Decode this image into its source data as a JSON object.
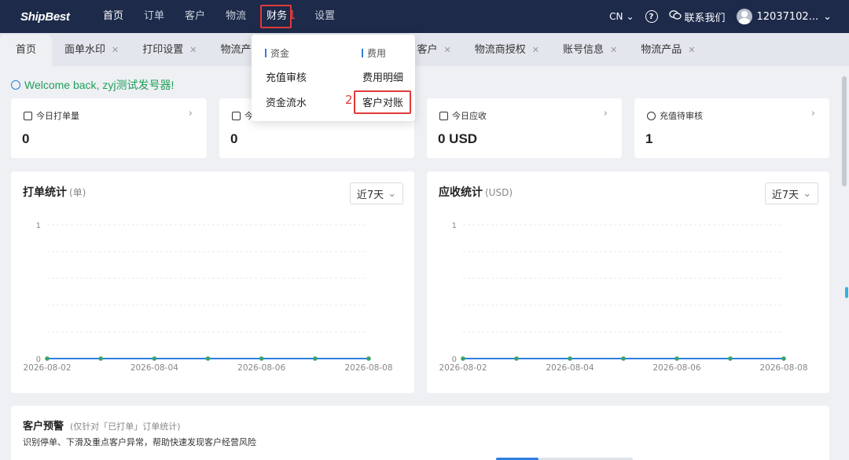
{
  "app": {
    "logo": "ShipBest"
  },
  "nav": {
    "items": [
      {
        "label": "首页"
      },
      {
        "label": "订单"
      },
      {
        "label": "客户"
      },
      {
        "label": "物流"
      },
      {
        "label": "财务"
      },
      {
        "label": "设置"
      }
    ],
    "step1": "1"
  },
  "top_right": {
    "lang": "CN",
    "contact": "联系我们",
    "user": "12037102..."
  },
  "tabs": [
    {
      "label": "首页"
    },
    {
      "label": "面单水印"
    },
    {
      "label": "打印设置"
    },
    {
      "label": "物流产品"
    },
    {
      "label": "客户"
    },
    {
      "label": "物流商授权"
    },
    {
      "label": "账号信息"
    },
    {
      "label": "物流产品"
    }
  ],
  "welcome": "Welcome back, zyj测试发号器!",
  "stats": [
    {
      "label": "今日打单量",
      "value": "0"
    },
    {
      "label": "今",
      "value": "0"
    },
    {
      "label": "今日应收",
      "value": "0 USD"
    },
    {
      "label": "充值待审核",
      "value": "1"
    }
  ],
  "dropdown": {
    "col1_head": "资金",
    "col2_head": "费用",
    "col1_items": [
      "充值审核",
      "资金流水"
    ],
    "col2_items": [
      "费用明细",
      "客户对账"
    ],
    "step2": "2"
  },
  "charts_ui": {
    "left_title": "打单统计",
    "left_unit": "(单)",
    "right_title": "应收统计",
    "right_unit": "(USD)",
    "range": "近7天"
  },
  "chart_data": [
    {
      "type": "line",
      "title": "打单统计",
      "ylabel": "单",
      "x": [
        "2026-08-02",
        "2026-08-03",
        "2026-08-04",
        "2026-08-05",
        "2026-08-06",
        "2026-08-07",
        "2026-08-08"
      ],
      "xticks": [
        "2026-08-02",
        "2026-08-04",
        "2026-08-06",
        "2026-08-08"
      ],
      "yticks": [
        "0",
        "1"
      ],
      "values": [
        0,
        0,
        0,
        0,
        0,
        0,
        0
      ],
      "ylim": [
        0,
        1
      ],
      "color": "#2f7fe0",
      "point_color": "#3ba26a"
    },
    {
      "type": "line",
      "title": "应收统计",
      "ylabel": "USD",
      "x": [
        "2026-08-02",
        "2026-08-03",
        "2026-08-04",
        "2026-08-05",
        "2026-08-06",
        "2026-08-07",
        "2026-08-08"
      ],
      "xticks": [
        "2026-08-02",
        "2026-08-04",
        "2026-08-06",
        "2026-08-08"
      ],
      "yticks": [
        "0",
        "1"
      ],
      "values": [
        0,
        0,
        0,
        0,
        0,
        0,
        0
      ],
      "ylim": [
        0,
        1
      ],
      "color": "#2f7fe0",
      "point_color": "#3ba26a"
    }
  ],
  "alert": {
    "title": "客户预警",
    "subtitle": "(仅针对「已打单」订单统计)",
    "desc": "识别停单、下滑及重点客户异常，帮助快速发现客户经营风险"
  }
}
